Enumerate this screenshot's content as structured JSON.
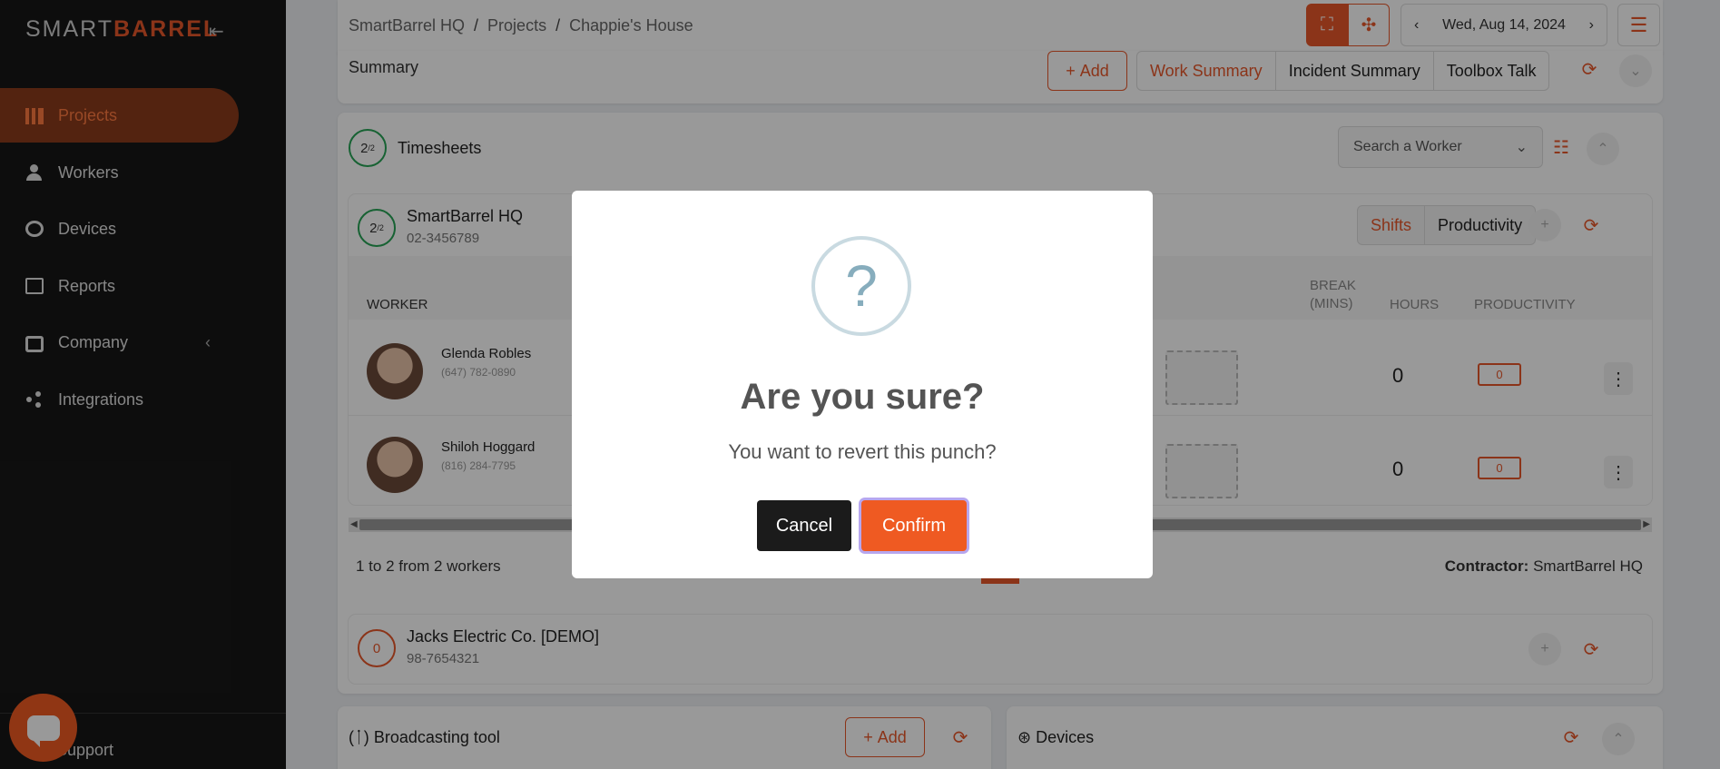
{
  "sidebar": {
    "logo_left": "SMART",
    "logo_right": "BARREL",
    "items": [
      {
        "label": "Projects"
      },
      {
        "label": "Workers"
      },
      {
        "label": "Devices"
      },
      {
        "label": "Reports"
      },
      {
        "label": "Company"
      },
      {
        "label": "Integrations"
      }
    ],
    "support_label": "Support"
  },
  "topbar": {
    "breadcrumb": [
      "SmartBarrel HQ",
      "Projects",
      "Chappie's House"
    ],
    "date": "Wed, Aug 14, 2024"
  },
  "summary": {
    "title": "Summary",
    "add_label": "Add",
    "tabs": [
      "Work Summary",
      "Incident Summary",
      "Toolbox Talk"
    ]
  },
  "timesheets": {
    "badge": "2",
    "badge_sub": "/2",
    "title": "Timesheets",
    "search_placeholder": "Search a Worker"
  },
  "contractor1": {
    "badge": "2",
    "badge_sub": "/2",
    "name": "SmartBarrel HQ",
    "id": "02-3456789",
    "tabs": [
      "Shifts",
      "Productivity"
    ],
    "columns": {
      "worker": "WORKER",
      "break": "BREAK (MINS)",
      "hours": "HOURS",
      "productivity": "PRODUCTIVITY"
    },
    "workers": [
      {
        "name": "Glenda Robles",
        "phone": "(647) 782-0890",
        "hours": "0",
        "productivity": "0"
      },
      {
        "name": "Shiloh Hoggard",
        "phone": "(816) 284-7795",
        "hours": "0",
        "productivity": "0"
      }
    ],
    "footer_count": "1 to 2 from 2 workers",
    "contractor_label": "Contractor:",
    "contractor_name": "SmartBarrel HQ"
  },
  "contractor2": {
    "badge": "0",
    "name": "Jacks Electric Co. [DEMO]",
    "id": "98-7654321"
  },
  "broadcast": {
    "title": "Broadcasting tool",
    "add_label": "Add"
  },
  "devices": {
    "title": "Devices"
  },
  "modal": {
    "icon": "?",
    "title": "Are you sure?",
    "text": "You want to revert this punch?",
    "cancel": "Cancel",
    "confirm": "Confirm"
  },
  "colors": {
    "accent": "#e8572a",
    "sidebar_bg": "#171717",
    "confirm_bg": "#ef5a22"
  }
}
